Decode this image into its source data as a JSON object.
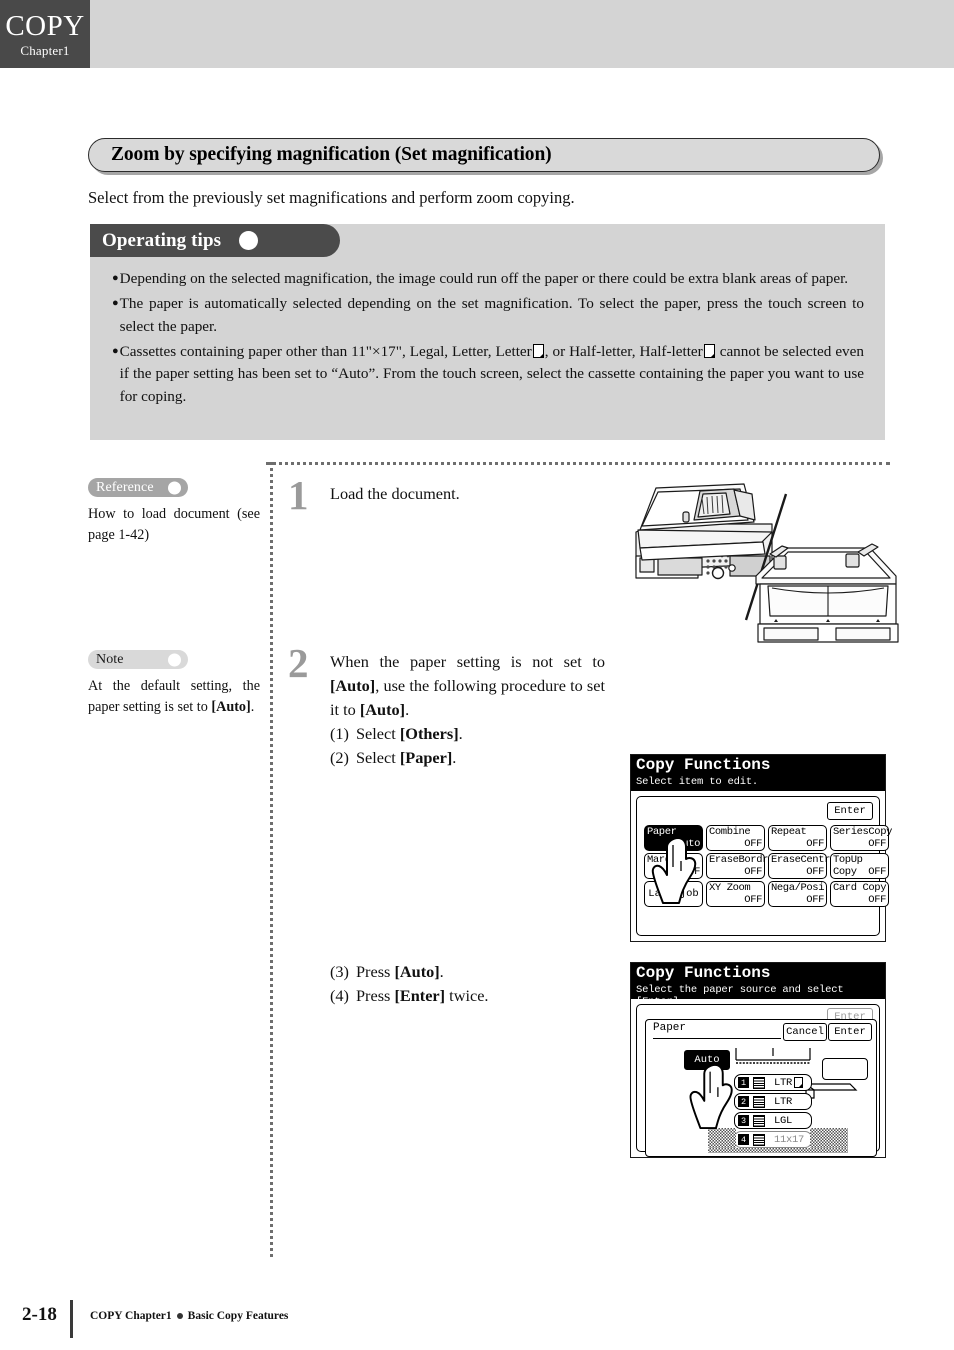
{
  "header": {
    "chapter_tab_main": "COPY",
    "chapter_tab_sub": "Chapter1"
  },
  "section": {
    "title": "Zoom by specifying magnification (Set magnification)",
    "lead": "Select from the previously set magnifications and perform zoom copying."
  },
  "tips": {
    "heading": "Operating tips",
    "items": [
      {
        "before": "Depending on the selected magnification, the image could run off the paper or there could be extra blank areas of paper.",
        "after": ""
      },
      {
        "before": "The paper is automatically selected depending on the set magnification. To select the paper, press the touch screen to select the paper.",
        "after": ""
      },
      {
        "before": "Cassettes containing paper other than 11\"×17\", Legal, Letter, Letter",
        "middle": ", or Half-letter, Half-letter",
        "after": " cannot be selected even if the paper setting has been set to “Auto”. From the touch screen, select the cassette containing the paper you want to use for coping."
      }
    ]
  },
  "side_notes": [
    {
      "badge": "Reference",
      "text": "How to load document (see page 1-42)"
    },
    {
      "badge": "Note",
      "text_a": "At the default setting, the paper setting is set to ",
      "text_b": "[Auto]",
      "text_c": "."
    }
  ],
  "steps": [
    {
      "number": "1",
      "text": "Load the document."
    },
    {
      "number": "2",
      "line1_a": "When the paper setting is not set to ",
      "line1_b": "[Auto]",
      "line1_c": ", use the following procedure to set it to ",
      "line1_d": "[Auto]",
      "line1_e": ".",
      "substeps": [
        {
          "n": "(1)",
          "a": "Select ",
          "b": "[Others]",
          "c": "."
        },
        {
          "n": "(2)",
          "a": "Select ",
          "b": "[Paper]",
          "c": "."
        },
        {
          "n": "(3)",
          "a": "Press ",
          "b": "[Auto]",
          "c": "."
        },
        {
          "n": "(4)",
          "a": "Press ",
          "b": "[Enter]",
          "c": " twice."
        }
      ]
    }
  ],
  "lcd_functions": {
    "title": "Copy Functions",
    "subtitle": "Select item to edit.",
    "enter_label": "Enter",
    "buttons": [
      {
        "label": "Paper",
        "value": "Auto",
        "selected": true
      },
      {
        "label": "Combine",
        "value": "OFF",
        "selected": false
      },
      {
        "label": "Repeat",
        "value": "OFF",
        "selected": false
      },
      {
        "label": "SeriesCopy",
        "value": "OFF",
        "selected": false
      },
      {
        "label": "Margin",
        "value": "OFF",
        "selected": false
      },
      {
        "label": "EraseBordr",
        "value": "OFF",
        "selected": false
      },
      {
        "label": "EraseCentr",
        "value": "OFF",
        "selected": false
      },
      {
        "label": "TopUp Copy",
        "value": "OFF",
        "selected": false
      },
      {
        "label": "Last job",
        "value": "",
        "selected": false
      },
      {
        "label": "XY Zoom",
        "value": "OFF",
        "selected": false
      },
      {
        "label": "Nega/Posi",
        "value": "OFF",
        "selected": false
      },
      {
        "label": "Card Copy",
        "value": "OFF",
        "selected": false
      }
    ]
  },
  "lcd_paper": {
    "title": "Copy Functions",
    "subtitle": "Select the paper source and select [Enter].",
    "dialog_title": "Paper",
    "cancel_label": "Cancel",
    "enter_label": "Enter",
    "auto_label": "Auto",
    "trays": [
      {
        "num": "1",
        "size": "LTR",
        "rotated": true,
        "dim": false
      },
      {
        "num": "2",
        "size": "LTR",
        "rotated": false,
        "dim": false
      },
      {
        "num": "3",
        "size": "LGL",
        "rotated": false,
        "dim": false
      },
      {
        "num": "4",
        "size": "11x17",
        "rotated": false,
        "dim": true
      }
    ]
  },
  "footer": {
    "page": "2-18",
    "text_a": "COPY Chapter1",
    "text_b": "Basic Copy Features"
  }
}
